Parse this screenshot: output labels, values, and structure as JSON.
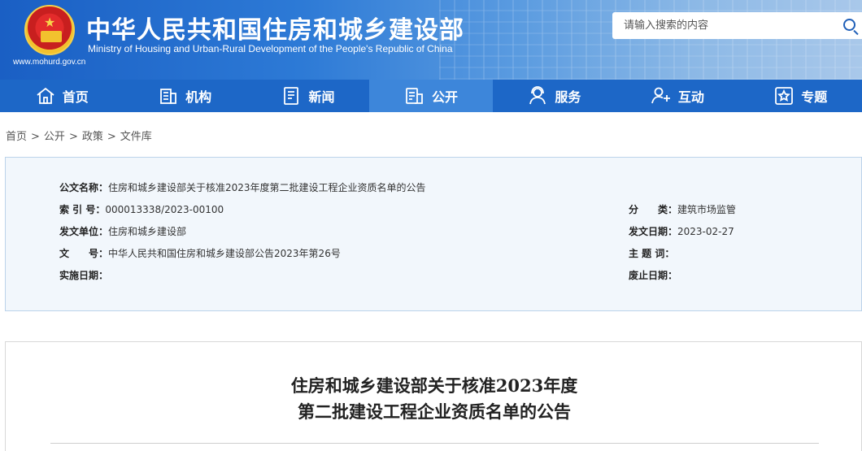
{
  "header": {
    "title_cn": "中华人民共和国住房和城乡建设部",
    "title_en": "Ministry of Housing and Urban-Rural Development of the People's Republic of China",
    "url": "www.mohurd.gov.cn",
    "emblem_icon": "national-emblem",
    "search_placeholder": "请输入搜索的内容"
  },
  "nav": {
    "items": [
      {
        "label": "首页",
        "icon": "home-icon"
      },
      {
        "label": "机构",
        "icon": "building-icon"
      },
      {
        "label": "新闻",
        "icon": "news-icon"
      },
      {
        "label": "公开",
        "icon": "document-icon"
      },
      {
        "label": "服务",
        "icon": "service-person-icon"
      },
      {
        "label": "互动",
        "icon": "interaction-icon"
      },
      {
        "label": "专题",
        "icon": "star-icon"
      }
    ],
    "active_index": 3
  },
  "breadcrumb": [
    "首页",
    "公开",
    "政策",
    "文件库"
  ],
  "meta": {
    "title_label": "公文名称：",
    "title_value": "住房和城乡建设部关于核准2023年度第二批建设工程企业资质名单的公告",
    "index_label": "索 引 号：",
    "index_value": "000013338/2023-00100",
    "category_label": "分　　类：",
    "category_value": "建筑市场监管",
    "issuer_label": "发文单位：",
    "issuer_value": "住房和城乡建设部",
    "date_label": "发文日期：",
    "date_value": "2023-02-27",
    "docno_label": "文　　号：",
    "docno_value": "中华人民共和国住房和城乡建设部公告2023年第26号",
    "subject_label": "主 题 词：",
    "subject_value": "",
    "effective_label": "实施日期：",
    "effective_value": "",
    "expire_label": "废止日期：",
    "expire_value": ""
  },
  "document": {
    "title_line1": "住房和城乡建设部关于核准2023年度",
    "title_line2": "第二批建设工程企业资质名单的公告"
  },
  "colors": {
    "nav_bg": "#1d67c7",
    "nav_active": "#3d86da",
    "meta_bg": "#f2f7fc"
  }
}
